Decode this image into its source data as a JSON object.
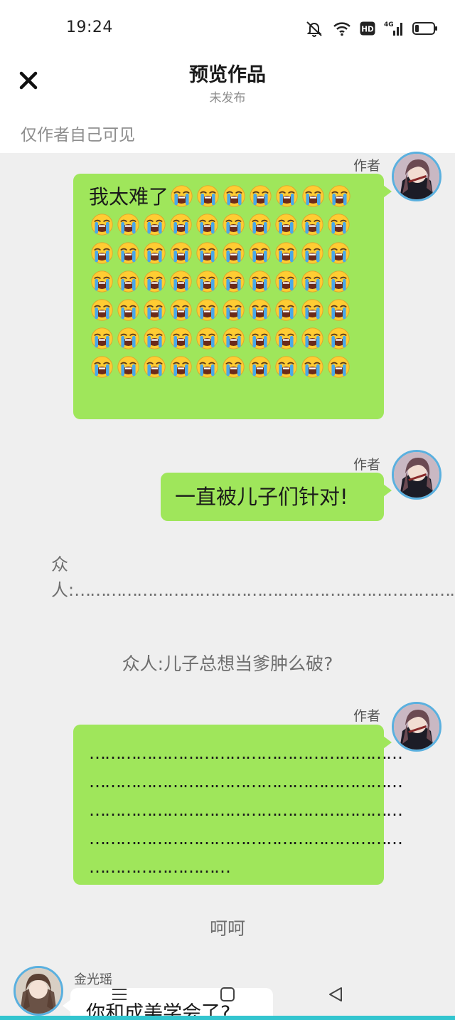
{
  "status_bar": {
    "time": "19:24",
    "icons": [
      "mute-bell-icon",
      "wifi-icon",
      "hd-icon",
      "4g-signal-icon",
      "battery-icon"
    ],
    "hd_label": "HD",
    "network_label": "4G"
  },
  "header": {
    "title": "预览作品",
    "subtitle": "未发布",
    "close_icon": "close-icon",
    "visibility_note": "仅作者自己可见"
  },
  "messages": [
    {
      "sender": "作者",
      "side": "right",
      "text_lead": "我太难了",
      "emoji": "loudly-crying-face",
      "emoji_count": 67
    },
    {
      "sender": "作者",
      "side": "right",
      "text": "一直被儿子们针对!"
    },
    {
      "type": "narration",
      "speaker": "众人:",
      "text": "…………………………………………………………………………………………………………………………………………………………"
    },
    {
      "type": "narration",
      "text": "众人:儿子总想当爹肿么破?"
    },
    {
      "sender": "作者",
      "side": "right",
      "lines": [
        "……………………………………………………",
        "……………………………………………………",
        "……………………………………………………",
        "……………………………………………………",
        "………………………"
      ]
    },
    {
      "type": "narration",
      "text": "呵呵"
    },
    {
      "sender": "金光瑶",
      "side": "left",
      "text": "你和成美学会了?"
    }
  ],
  "nav_bar": {
    "buttons": [
      "menu-icon",
      "home-square-icon",
      "back-triangle-icon"
    ]
  },
  "colors": {
    "bubble_green": "#9fe65b",
    "background": "#efefef",
    "avatar_ring": "#5ab0df",
    "accent_strip": "#33c5cf"
  }
}
